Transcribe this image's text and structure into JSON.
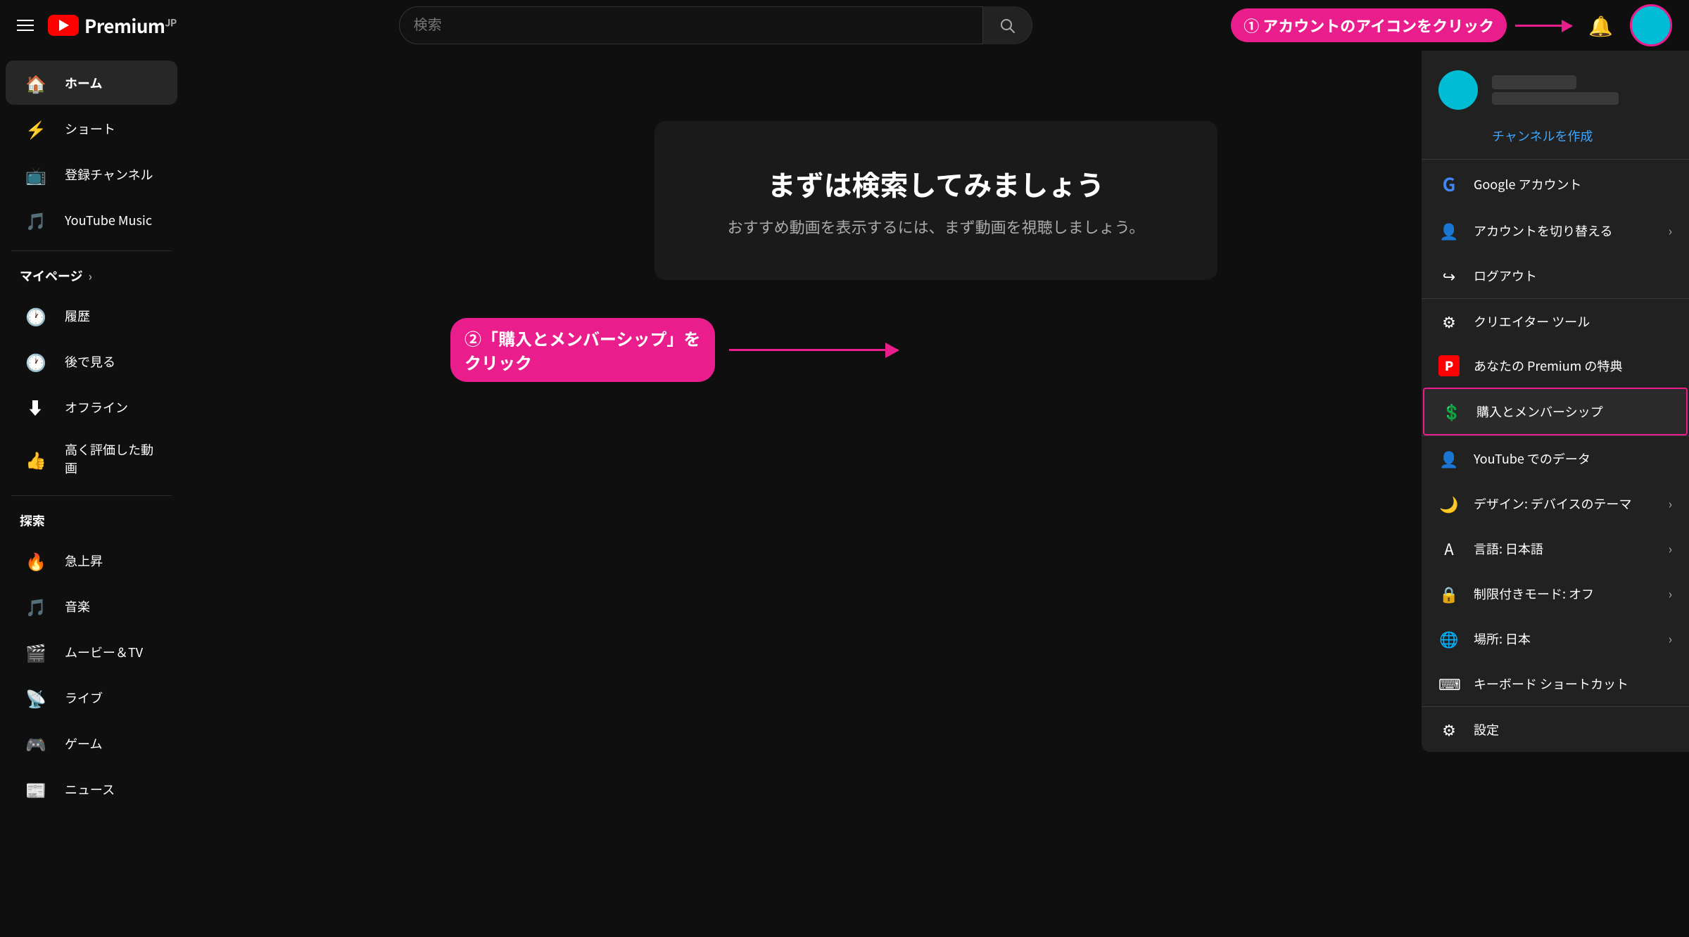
{
  "header": {
    "menu_label": "メニュー",
    "logo_text": "Premium",
    "logo_sub": "JP",
    "search_placeholder": "検索",
    "annotation1": "① アカウントのアイコンをクリック"
  },
  "sidebar": {
    "home": "ホーム",
    "shorts": "ショート",
    "subscriptions": "登録チャンネル",
    "music": "YouTube Music",
    "my_page": "マイページ",
    "history": "履歴",
    "watch_later": "後で見る",
    "offline": "オフライン",
    "liked": "高く評価した動画",
    "explore": "探索",
    "trending": "急上昇",
    "music_explore": "音楽",
    "movies": "ムービー＆TV",
    "live": "ライブ",
    "gaming": "ゲーム",
    "news": "ニュース"
  },
  "main": {
    "search_prompt_title": "まずは検索してみましょう",
    "search_prompt_subtitle": "おすすめ動画を表示するには、まず動画を視聴しましょう。"
  },
  "dropdown": {
    "create_channel": "チャンネルを作成",
    "google_account": "Google アカウント",
    "switch_account": "アカウントを切り替える",
    "logout": "ログアウト",
    "creator_tools": "クリエイター ツール",
    "premium_benefits": "あなたの Premium の特典",
    "purchases": "購入とメンバーシップ",
    "youtube_data": "YouTube でのデータ",
    "design": "デザイン: デバイスのテーマ",
    "language": "言語: 日本語",
    "restricted": "制限付きモード: オフ",
    "location": "場所: 日本",
    "keyboard": "キーボード ショートカット",
    "settings": "設定"
  },
  "annotation": {
    "text1": "① アカウントのアイコンをクリック",
    "text2_line1": "②「購入とメンバーシップ」を",
    "text2_line2": "クリック"
  }
}
